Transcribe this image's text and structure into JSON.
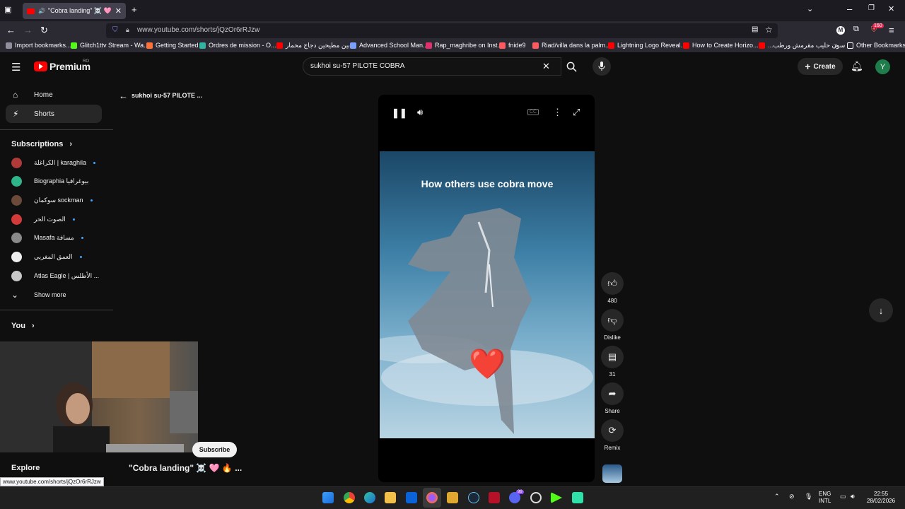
{
  "browser": {
    "tab_title": "\"Cobra landing\" ☠️ 🩷 🔥 #",
    "url": "www.youtube.com/shorts/jQzOr6rRJzw",
    "status_url": "www.youtube.com/shorts/jQzOr6rRJzw",
    "notif_badge": "160",
    "bookmarks": [
      {
        "label": "Import bookmarks...",
        "color": "#8f8f9d"
      },
      {
        "label": "Glitch1ttv Stream - Wa...",
        "color": "#53fc18"
      },
      {
        "label": "Getting Started",
        "color": "#ff7139"
      },
      {
        "label": "Ordres de mission - O...",
        "color": "#2fb5a0"
      },
      {
        "label": "بين مطيحين دجاج محمار...",
        "color": "#ff0000"
      },
      {
        "label": "Advanced School Man...",
        "color": "#7aa0ff"
      },
      {
        "label": "Rap_maghribe on Inst...",
        "color": "#e1306c"
      },
      {
        "label": "fnide9",
        "color": "#ff5a5f"
      },
      {
        "label": "Riad/villa dans la palm...",
        "color": "#ff5a5f"
      },
      {
        "label": "Lightning Logo Reveal...",
        "color": "#ff0000"
      },
      {
        "label": "How to Create Horizo...",
        "color": "#ff0000"
      },
      {
        "label": "...سون حليب مقرمش ورطب",
        "color": "#ff0000"
      }
    ],
    "other_bookmarks": "Other Bookmarks"
  },
  "youtube": {
    "logo_text": "Premium",
    "logo_region": "RO",
    "search_query": "sukhoi su-57 PILOTE  COBRA",
    "create_label": "Create",
    "avatar_letter": "Y",
    "back_title": "sukhoi su-57 PILOTE ...",
    "nav": [
      {
        "label": "Home",
        "icon": "home-icon"
      },
      {
        "label": "Shorts",
        "icon": "shorts-icon"
      }
    ],
    "subscriptions_label": "Subscriptions",
    "subscriptions": [
      {
        "name": "الكراغلة | karaghila",
        "color": "#b03a3a",
        "dot": true
      },
      {
        "name": "Biographia بيوغرافيا",
        "color": "#2fb58a",
        "dot": false
      },
      {
        "name": "سوكمان sockman",
        "color": "#6b4a3a",
        "dot": true
      },
      {
        "name": "الصوت الحر",
        "color": "#d43a3a",
        "dot": true
      },
      {
        "name": "Masafa مسافة",
        "color": "#8a8a8a",
        "dot": true
      },
      {
        "name": "العمق المغربي",
        "color": "#f0f0f0",
        "dot": true
      },
      {
        "name": "Atlas Eagle | الأطلس ...",
        "color": "#c8c8c8",
        "dot": false
      }
    ],
    "show_more": "Show more",
    "you_label": "You",
    "explore_label": "Explore",
    "short": {
      "caption": "How others use cobra move",
      "title": "\"Cobra landing\" ☠️ 🩷 🔥 ...",
      "subscribe": "Subscribe",
      "likes": "480",
      "dislike_label": "Dislike",
      "comments": "31",
      "share_label": "Share",
      "remix_label": "Remix"
    }
  },
  "taskbar": {
    "lang_top": "ENG",
    "lang_bottom": "INTL",
    "time": "22:55",
    "date": "28/02/2026",
    "discord_badge": "99"
  }
}
